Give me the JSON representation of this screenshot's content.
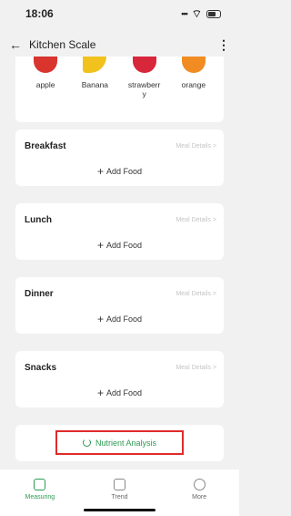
{
  "status": {
    "time": "18:06",
    "signal": "•••",
    "wifi": "wifi"
  },
  "header": {
    "title": "Kitchen Scale",
    "back_icon": "back-arrow-icon",
    "menu_icon": "kebab-icon"
  },
  "fruits": [
    {
      "label": "apple",
      "icon": "apple-icon"
    },
    {
      "label": "Banana",
      "icon": "banana-icon"
    },
    {
      "label": "strawberr\ny",
      "icon": "strawberry-icon"
    },
    {
      "label": "orange",
      "icon": "orange-icon"
    }
  ],
  "meals": [
    {
      "title": "Breakfast",
      "details": "Meal Details >",
      "add": "Add Food"
    },
    {
      "title": "Lunch",
      "details": "Meal Details >",
      "add": "Add Food"
    },
    {
      "title": "Dinner",
      "details": "Meal Details >",
      "add": "Add Food"
    },
    {
      "title": "Snacks",
      "details": "Meal Details >",
      "add": "Add Food"
    }
  ],
  "analysis": {
    "label": "Nutrient Analysis",
    "icon": "loading-ring-icon",
    "accent": "#2d9a52",
    "highlight": "#e02b2b"
  },
  "nav": [
    {
      "label": "Measuring",
      "icon": "scale-icon",
      "active": true
    },
    {
      "label": "Trend",
      "icon": "chart-icon",
      "active": false
    },
    {
      "label": "More",
      "icon": "more-icon",
      "active": false
    }
  ]
}
